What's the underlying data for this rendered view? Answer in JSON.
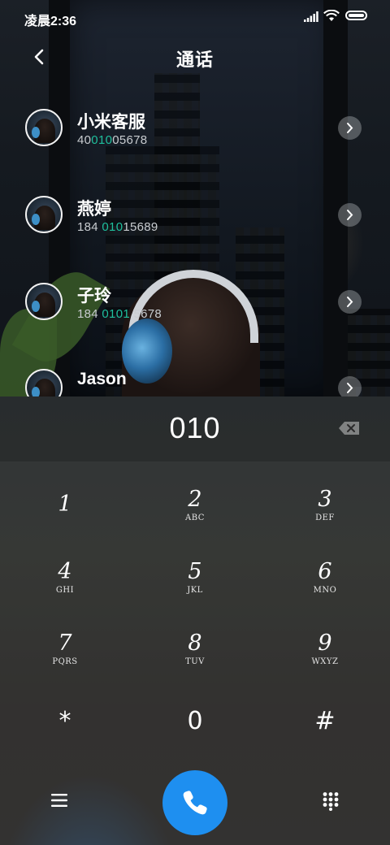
{
  "status_bar": {
    "time": "凌晨2:36",
    "icons": [
      "signal-icon",
      "wifi-icon",
      "battery-icon"
    ]
  },
  "header": {
    "title": "通话",
    "back_icon": "chevron-left-icon"
  },
  "contacts": [
    {
      "name": "小米客服",
      "number_pre": "40",
      "number_match": "010",
      "number_post": "05678"
    },
    {
      "name": "燕婷",
      "number_pre": "184 ",
      "number_match": "010",
      "number_post": "15689"
    },
    {
      "name": "子玲",
      "number_pre": "184 ",
      "number_match": "0101",
      "number_post": " 5678"
    },
    {
      "name": "Jason",
      "number_pre": "",
      "number_match": "",
      "number_post": ""
    }
  ],
  "dialer": {
    "input": "010",
    "keys": [
      {
        "digit": "1",
        "letters": ""
      },
      {
        "digit": "2",
        "letters": "ABC"
      },
      {
        "digit": "3",
        "letters": "DEF"
      },
      {
        "digit": "4",
        "letters": "GHI"
      },
      {
        "digit": "5",
        "letters": "JKL"
      },
      {
        "digit": "6",
        "letters": "MNO"
      },
      {
        "digit": "7",
        "letters": "PQRS"
      },
      {
        "digit": "8",
        "letters": "TUV"
      },
      {
        "digit": "9",
        "letters": "WXYZ"
      },
      {
        "digit": "*",
        "letters": ""
      },
      {
        "digit": "0",
        "letters": ""
      },
      {
        "digit": "#",
        "letters": ""
      }
    ]
  },
  "bottom_bar": {
    "icons": [
      "menu-icon",
      "phone-icon",
      "keypad-icon"
    ]
  },
  "colors": {
    "accent": "#1e8ff0",
    "match_highlight": "#1fbf9d"
  }
}
